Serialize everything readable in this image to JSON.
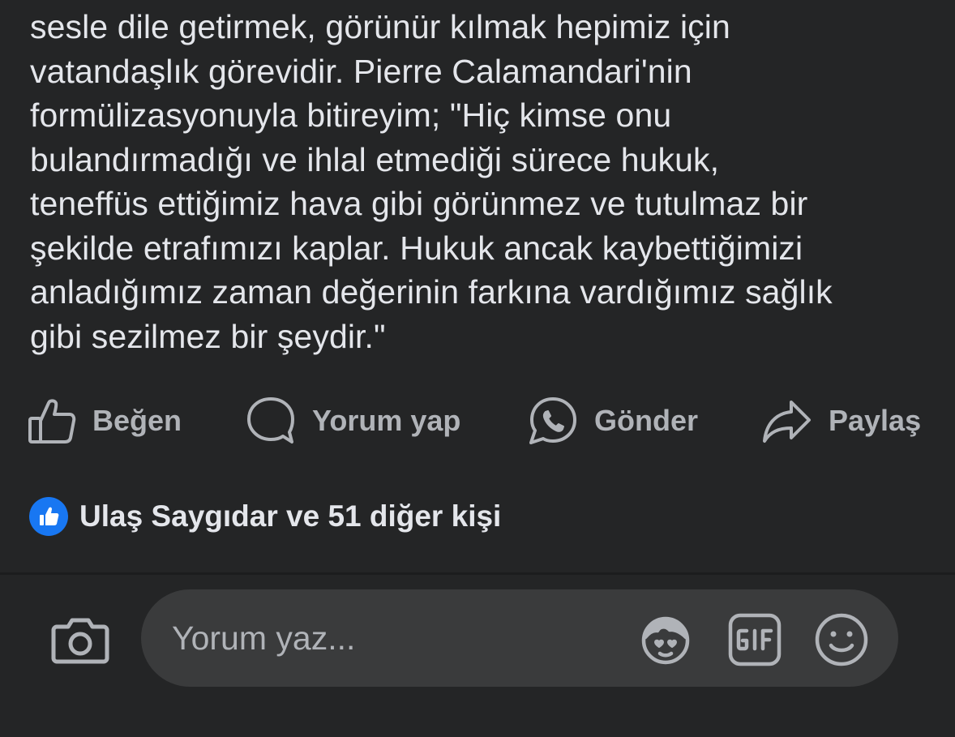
{
  "post": {
    "lines": [
      "sesle dile getirmek, görünür kılmak hepimiz için",
      "vatandaşlık görevidir. Pierre Calamandari'nin",
      "formülizasyonuyla bitireyim; \"Hiç kimse onu",
      "bulandırmadığı ve ihlal etmediği sürece hukuk,",
      "teneffüs ettiğimiz hava gibi görünmez ve tutulmaz bir",
      "şekilde etrafımızı kaplar. Hukuk ancak kaybettiğimizi",
      "anladığımız zaman değerinin farkına vardığımız sağlık",
      "gibi sezilmez bir şeydir.\""
    ]
  },
  "actions": {
    "like": {
      "label": "Beğen",
      "icon": "thumbs-up-outline-icon"
    },
    "comment": {
      "label": "Yorum yap",
      "icon": "speech-bubble-icon"
    },
    "send": {
      "label": "Gönder",
      "icon": "whatsapp-icon"
    },
    "share": {
      "label": "Paylaş",
      "icon": "share-arrow-icon"
    }
  },
  "reactions": {
    "icon": "like-reaction-badge-icon",
    "text": "Ulaş Saygıdar ve 51 diğer kişi"
  },
  "composer": {
    "placeholder": "Yorum yaz...",
    "value": "",
    "icons": [
      "camera-icon",
      "avatar-sticker-icon",
      "gif-icon",
      "emoji-smiley-icon"
    ]
  },
  "colors": {
    "background": "#242526",
    "text_primary": "#e4e6eb",
    "text_secondary": "#b0b3b8",
    "input_background": "#3a3b3c",
    "like_blue": "#1877f2"
  }
}
